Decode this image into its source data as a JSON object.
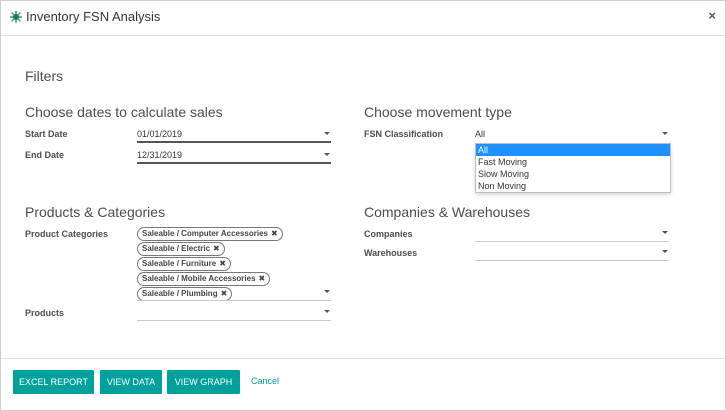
{
  "dialog": {
    "title": "Inventory FSN Analysis",
    "close_glyph": "×"
  },
  "filters": {
    "heading": "Filters",
    "dates": {
      "heading": "Choose dates to calculate sales",
      "start_label": "Start Date",
      "start_value": "01/01/2019",
      "end_label": "End Date",
      "end_value": "12/31/2019"
    },
    "movement": {
      "heading": "Choose movement type",
      "fsn_label": "FSN Classification",
      "fsn_value": "All",
      "options": [
        "All",
        "Fast Moving",
        "Slow Moving",
        "Non Moving"
      ]
    },
    "products": {
      "heading": "Products & Categories",
      "categories_label": "Product Categories",
      "category_tags": [
        "Saleable / Computer Accessories",
        "Saleable / Electric",
        "Saleable / Furniture",
        "Saleable / Mobile Accessories",
        "Saleable / Plumbing"
      ],
      "products_label": "Products",
      "tag_remove_glyph": "✖"
    },
    "companies": {
      "heading": "Companies & Warehouses",
      "companies_label": "Companies",
      "warehouses_label": "Warehouses"
    }
  },
  "footer": {
    "excel_label": "EXCEL REPORT",
    "view_data_label": "VIEW DATA",
    "view_graph_label": "VIEW GRAPH",
    "cancel_label": "Cancel"
  },
  "colors": {
    "accent": "#00a09d",
    "selected_option": "#1e90ff"
  },
  "icons": {
    "app": "inventory-app-icon",
    "close": "close-icon",
    "caret": "caret-down-icon",
    "tag_remove": "tag-remove-icon"
  }
}
